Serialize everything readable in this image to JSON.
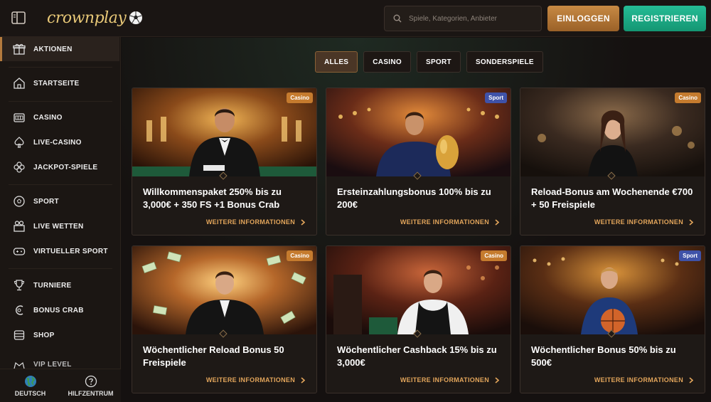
{
  "header": {
    "logo_text": "crownplay",
    "search_placeholder": "Spiele, Kategorien, Anbieter",
    "login_label": "EINLOGGEN",
    "register_label": "REGISTRIEREN"
  },
  "sidebar": {
    "items": [
      {
        "label": "AKTIONEN",
        "icon": "gift-icon"
      },
      {
        "label": "STARTSEITE",
        "icon": "home-icon"
      },
      {
        "label": "CASINO",
        "icon": "slot-icon"
      },
      {
        "label": "LIVE-CASINO",
        "icon": "spade-icon"
      },
      {
        "label": "JACKPOT-SPIELE",
        "icon": "clover-icon"
      },
      {
        "label": "SPORT",
        "icon": "football-icon"
      },
      {
        "label": "LIVE WETTEN",
        "icon": "live-bet-icon"
      },
      {
        "label": "VIRTUELLER SPORT",
        "icon": "gamepad-icon"
      },
      {
        "label": "TURNIERE",
        "icon": "trophy-icon"
      },
      {
        "label": "BONUS CRAB",
        "icon": "crab-icon"
      },
      {
        "label": "SHOP",
        "icon": "shop-icon"
      },
      {
        "label": "VIP LEVEL",
        "icon": "vip-icon"
      }
    ],
    "footer": {
      "language_label": "DEUTSCH",
      "help_label": "HILFZENTRUM"
    }
  },
  "filters": [
    "ALLES",
    "CASINO",
    "SPORT",
    "SONDERSPIELE"
  ],
  "cards": [
    {
      "title": "Willkommenspaket 250% bis zu 3,000€ + 350 FS +1 Bonus Crab",
      "badge": "Casino",
      "more": "WEITERE INFORMATIONEN"
    },
    {
      "title": "Ersteinzahlungsbonus 100% bis zu 200€",
      "badge": "Sport",
      "more": "WEITERE INFORMATIONEN"
    },
    {
      "title": "Reload-Bonus am Wochenende €700 + 50 Freispiele",
      "badge": "Casino",
      "more": "WEITERE INFORMATIONEN"
    },
    {
      "title": "Wöchentlicher Reload Bonus 50 Freispiele",
      "badge": "Casino",
      "more": "WEITERE INFORMATIONEN"
    },
    {
      "title": "Wöchentlicher Cashback 15% bis zu 3,000€",
      "badge": "Casino",
      "more": "WEITERE INFORMATIONEN"
    },
    {
      "title": "Wöchentlicher Bonus 50% bis zu 500€",
      "badge": "Sport",
      "more": "WEITERE INFORMATIONEN"
    }
  ],
  "colors": {
    "accent_gold": "#c88a44",
    "register_green": "#1aa882",
    "casino_badge": "#c57b2e",
    "sport_badge": "#3f52a8"
  }
}
